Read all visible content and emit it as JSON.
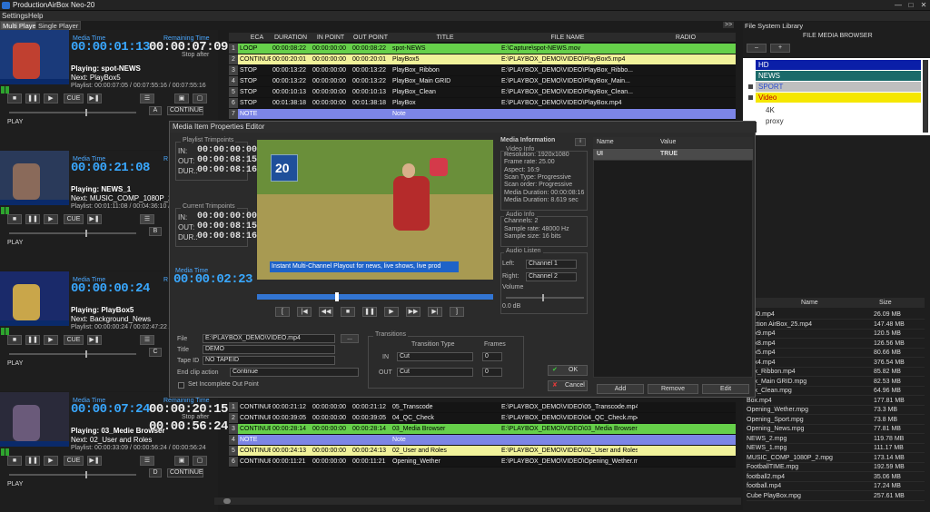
{
  "window": {
    "title": "ProductionAirBox Neo-20"
  },
  "menu": {
    "settings": "Settings",
    "help": "Help"
  },
  "tabs": [
    {
      "label": "Multi Player"
    },
    {
      "label": "Single Player"
    }
  ],
  "players": [
    {
      "media_time_label": "Media Time",
      "media_time": "00:00:01:13",
      "remaining_label": "Remaining Time",
      "remaining_time": "00:00:07:09",
      "stop_after": "Stop after",
      "playing": "Playing: spot-NEWS",
      "next": "Next: PlayBox5",
      "playlist": "Playlist: 00:00:07:05 / 00:07:55:16 / 00:07:55:16",
      "badge": "A",
      "mode": "CONTINUE",
      "play_label": "PLAY"
    },
    {
      "media_time_label": "Media Time",
      "media_time": "00:00:21:08",
      "remaining_label": "R",
      "remaining_time": "0",
      "stop_after": "",
      "playing": "Playing: NEWS_1",
      "next": "Next: MUSIC_COMP_1080P_2",
      "playlist": "Playlist: 00:01:11:08 / 00:04:36:10 / 0",
      "badge": "B",
      "mode": "",
      "play_label": "PLAY"
    },
    {
      "media_time_label": "Media Time",
      "media_time": "00:00:00:24",
      "remaining_label": "R",
      "remaining_time": "0",
      "stop_after": "",
      "playing": "Playing: PlayBox5",
      "next": "Next: Background_News",
      "playlist": "Playlist: 00:00:00:24 / 00:02:47:22 / 00:02",
      "badge": "C",
      "mode": "",
      "play_label": "PLAY"
    },
    {
      "media_time_label": "Media Time",
      "media_time": "00:00:07:24",
      "remaining_label": "Remaining Time",
      "remaining_time": "00:00:20:15",
      "stop_after": "Stop after",
      "remaining2": "00:00:56:24",
      "playing": "Playing: 03_Medie Browser",
      "next": "Next: 02_User and Roles",
      "playlist": "Playlist: 00:00:33:09 / 00:00:56:24 / 00:00:56:24",
      "badge": "D",
      "mode": "CONTINUE",
      "play_label": "PLAY"
    }
  ],
  "cue_label": "CUE",
  "playlist_top": {
    "headers": [
      "ECA",
      "DURATION",
      "IN POINT",
      "OUT POINT",
      "TITLE",
      "FILE NAME",
      "RADIO"
    ],
    "rows": [
      {
        "n": "1",
        "eca": "LOOP",
        "dur": "00:00:08:22",
        "in": "00:00:00:00",
        "out": "00:00:08:22",
        "title": "spot-NEWS",
        "file": "E:\\Capture\\spot-NEWS.mov",
        "style": "green"
      },
      {
        "n": "2",
        "eca": "CONTINUE",
        "dur": "00:00:20:01",
        "in": "00:00:00:00",
        "out": "00:00:20:01",
        "title": "PlayBox5",
        "file": "E:\\PLAYBOX_DEMO\\VIDEO\\PlayBox5.mp4",
        "style": "yellow"
      },
      {
        "n": "3",
        "eca": "STOP",
        "dur": "00:00:13:22",
        "in": "00:00:00:00",
        "out": "00:00:13:22",
        "title": "PlayBox_Ribbon",
        "file": "E:\\PLAYBOX_DEMO\\VIDEO\\PlayBox_Ribbo...",
        "style": "dark"
      },
      {
        "n": "4",
        "eca": "STOP",
        "dur": "00:00:13:22",
        "in": "00:00:00:00",
        "out": "00:00:13:22",
        "title": "PlayBox_Main GRID",
        "file": "E:\\PLAYBOX_DEMO\\VIDEO\\PlayBox_Main...",
        "style": "dark"
      },
      {
        "n": "5",
        "eca": "STOP",
        "dur": "00:00:10:13",
        "in": "00:00:00:00",
        "out": "00:00:10:13",
        "title": "PlayBox_Clean",
        "file": "E:\\PLAYBOX_DEMO\\VIDEO\\PlayBox_Clean...",
        "style": "dark"
      },
      {
        "n": "6",
        "eca": "STOP",
        "dur": "00:01:38:18",
        "in": "00:00:00:00",
        "out": "00:01:38:18",
        "title": "PlayBox",
        "file": "E:\\PLAYBOX_DEMO\\VIDEO\\PlayBox.mp4",
        "style": "dark"
      },
      {
        "n": "7",
        "eca": "NOTE",
        "dur": "",
        "in": "",
        "out": "",
        "title": "Note",
        "file": "",
        "style": "blue"
      }
    ]
  },
  "playlist_bottom": {
    "rows": [
      {
        "n": "1",
        "eca": "CONTINUE",
        "dur": "00:00:21:12",
        "in": "00:00:00:00",
        "out": "00:00:21:12",
        "title": "05_Transcode",
        "file": "E:\\PLAYBOX_DEMO\\VIDEO\\05_Transcode.mp4",
        "style": "dark"
      },
      {
        "n": "2",
        "eca": "CONTINUE",
        "dur": "00:00:39:05",
        "in": "00:00:00:00",
        "out": "00:00:39:05",
        "title": "04_QC_Check",
        "file": "E:\\PLAYBOX_DEMO\\VIDEO\\04_QC_Check.mp4",
        "style": "dark"
      },
      {
        "n": "3",
        "eca": "CONTINUE",
        "dur": "00:00:28:14",
        "in": "00:00:00:00",
        "out": "00:00:28:14",
        "title": "03_Media Browser",
        "file": "E:\\PLAYBOX_DEMO\\VIDEO\\03_Media Browser.mp4",
        "style": "green"
      },
      {
        "n": "4",
        "eca": "NOTE",
        "dur": "",
        "in": "",
        "out": "",
        "title": "Note",
        "file": "",
        "style": "blue"
      },
      {
        "n": "5",
        "eca": "CONTINUE",
        "dur": "00:00:24:13",
        "in": "00:00:00:00",
        "out": "00:00:24:13",
        "title": "02_User and Roles",
        "file": "E:\\PLAYBOX_DEMO\\VIDEO\\02_User and Roles.mp4",
        "style": "yellow"
      },
      {
        "n": "6",
        "eca": "CONTINUE",
        "dur": "00:00:11:21",
        "in": "00:00:00:00",
        "out": "00:00:11:21",
        "title": "Opening_Wether",
        "file": "E:\\PLAYBOX_DEMO\\VIDEO\\Opening_Wether.mpg",
        "style": "dark"
      }
    ]
  },
  "dialog": {
    "title": "Media Item Properties Editor",
    "playlist_trimpoints": "Playlist Trimpoints",
    "current_trimpoints": "Current Trimpoints",
    "in_label": "IN:",
    "out_label": "OUT:",
    "dur_label": "DUR.:",
    "pl_in": "00:00:00:00",
    "pl_out": "00:00:08:15",
    "pl_dur": "00:00:08:16",
    "cur_in": "00:00:00:00",
    "cur_out": "00:00:08:15",
    "cur_dur": "00:00:08:16",
    "media_time_label": "Media Time",
    "media_time": "00:00:02:23",
    "video_caption": "Instant Multi-Channel Playout for news, live shows, live prod",
    "video_logo": "20",
    "media_info": "Media Information",
    "video_info": "Video Info",
    "video_lines": [
      "Resolution: 1920x1080",
      "Frame rate: 25.00",
      "Aspect: 16:9",
      "Scan Type: Progressive",
      "Scan order: Progressive",
      "Media Duration: 00:00:08:16",
      "Media Duration: 8.619 sec"
    ],
    "audio_info": "Audio Info",
    "audio_lines": [
      "Channels: 2",
      "Sample rate: 48000 Hz",
      "Sample size: 16 bits"
    ],
    "audio_listen": "Audio Listen",
    "left_label": "Left:",
    "left_value": "Channel 1",
    "right_label": "Right:",
    "right_value": "Channel 2",
    "volume_label": "Volume",
    "volume_value": "0.0 dB",
    "info_btn": "i",
    "file_label": "File",
    "file_value": "E:\\PLAYBOX_DEMO\\VIDEO.mp4",
    "browse_btn": "...",
    "title_label": "Title",
    "title_value": "DEMO",
    "tapeid_label": "Tape ID",
    "tapeid_value": "NO TAPEID",
    "endclip_label": "End clip action",
    "endclip_value": "Continue",
    "incomplete_label": "Set Incomplete Out Point",
    "transitions": "Transitions",
    "trans_type": "Transition Type",
    "frames": "Frames",
    "in_t": "IN",
    "in_t_value": "Cut",
    "in_frames": "0",
    "out_t": "OUT",
    "out_t_value": "Cut",
    "out_frames": "0",
    "ok": "OK",
    "cancel": "Cancel",
    "props_headers": [
      "Name",
      "Value"
    ],
    "props_rows": [
      {
        "name": "UI",
        "value": "TRUE"
      }
    ],
    "add": "Add",
    "remove": "Remove",
    "edit": "Edit"
  },
  "right_panel": {
    "title": "File System Library",
    "browser_title": "FILE MEDIA BROWSER",
    "tree": [
      {
        "label": "HD",
        "bg": "#0a1fa8",
        "fg": "#ffffff"
      },
      {
        "label": "NEWS",
        "bg": "#1a6a6a",
        "fg": "#ffffff"
      },
      {
        "label": "SPORT",
        "bg": "#bfbfbf",
        "fg": "#2a4bd0"
      },
      {
        "label": "Video",
        "bg": "#f5e700",
        "fg": "#c00000"
      },
      {
        "label": "4K",
        "bg": "",
        "fg": "#ddd"
      },
      {
        "label": "proxy",
        "bg": "",
        "fg": "#ddd"
      }
    ],
    "headers": [
      "Name",
      "Size"
    ],
    "files": [
      {
        "name": "y_40.mp4",
        "size": "26.09 MB"
      },
      {
        "name": "duction AirBox_25.mp4",
        "size": "147.48 MB"
      },
      {
        "name": "Box9.mp4",
        "size": "120.5 MB"
      },
      {
        "name": "Box8.mp4",
        "size": "126.56 MB"
      },
      {
        "name": "Box5.mp4",
        "size": "80.66 MB"
      },
      {
        "name": "Box4.mp4",
        "size": "376.54 MB"
      },
      {
        "name": "Box_Ribbon.mp4",
        "size": "85.82 MB"
      },
      {
        "name": "Box_Main GRID.mpg",
        "size": "82.53 MB"
      },
      {
        "name": "Box_Clean.mpg",
        "size": "64.96 MB"
      },
      {
        "name": "Box.mp4",
        "size": "177.81 MB"
      },
      {
        "name": "Opening_Wether.mpg",
        "size": "73.3 MB"
      },
      {
        "name": "Opening_Sport.mpg",
        "size": "73.8 MB"
      },
      {
        "name": "Opening_News.mpg",
        "size": "77.81 MB"
      },
      {
        "name": "NEWS_2.mpg",
        "size": "119.78 MB"
      },
      {
        "name": "NEWS_1.mpg",
        "size": "111.17 MB"
      },
      {
        "name": "MUSIC_COMP_1080P_2.mpg",
        "size": "173.14 MB"
      },
      {
        "name": "FootballTIME.mpg",
        "size": "192.59 MB"
      },
      {
        "name": "football2.mp4",
        "size": "35.06 MB"
      },
      {
        "name": "football.mp4",
        "size": "17.24 MB"
      },
      {
        "name": "Cube PlayBox.mpg",
        "size": "257.61 MB"
      }
    ]
  },
  "expand_btn": ">>"
}
